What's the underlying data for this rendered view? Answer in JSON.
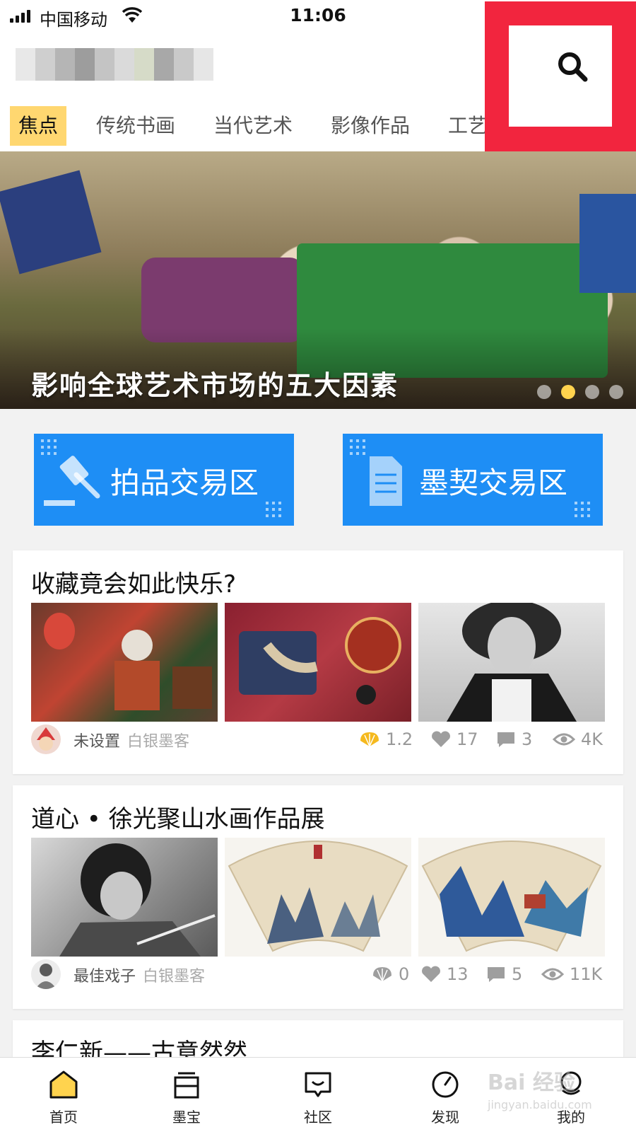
{
  "status_bar": {
    "carrier": "中国移动",
    "time": "11:06"
  },
  "tabs": [
    {
      "label": "焦点",
      "active": true
    },
    {
      "label": "传统书画",
      "active": false
    },
    {
      "label": "当代艺术",
      "active": false
    },
    {
      "label": "影像作品",
      "active": false
    },
    {
      "label": "工艺美术",
      "active": false
    }
  ],
  "search": {
    "icon": "search-icon",
    "highlight_color": "#f2253e"
  },
  "banner": {
    "title": "影响全球艺术市场的五大因素",
    "slide_count": 4,
    "active_slide": 2
  },
  "trade": {
    "auction_label": "拍品交易区",
    "contract_label": "墨契交易区",
    "color": "#1e8ef5"
  },
  "posts": [
    {
      "title": "收藏竟会如此快乐?",
      "author": "未设置",
      "rank": "白银墨客",
      "shells": "1.2",
      "likes": "17",
      "comments": "3",
      "views": "4K"
    },
    {
      "title": "道心 • 徐光聚山水画作品展",
      "author": "最佳戏子",
      "rank": "白银墨客",
      "shells": "0",
      "likes": "13",
      "comments": "5",
      "views": "11K"
    },
    {
      "title": "李仁新——古意然然"
    }
  ],
  "nav": [
    {
      "label": "首页",
      "icon": "home-icon",
      "active": true
    },
    {
      "label": "墨宝",
      "icon": "wallet-icon",
      "active": false
    },
    {
      "label": "社区",
      "icon": "chat-icon",
      "active": false
    },
    {
      "label": "发现",
      "icon": "compass-icon",
      "active": false
    },
    {
      "label": "我的",
      "icon": "user-icon",
      "active": false
    }
  ],
  "watermark": {
    "text": "Bai 经验",
    "url": "jingyan.baidu.com"
  },
  "colors": {
    "accent_tab": "#ffd770",
    "brand_blue": "#1e8ef5",
    "shell_gold": "#f5b91e"
  }
}
